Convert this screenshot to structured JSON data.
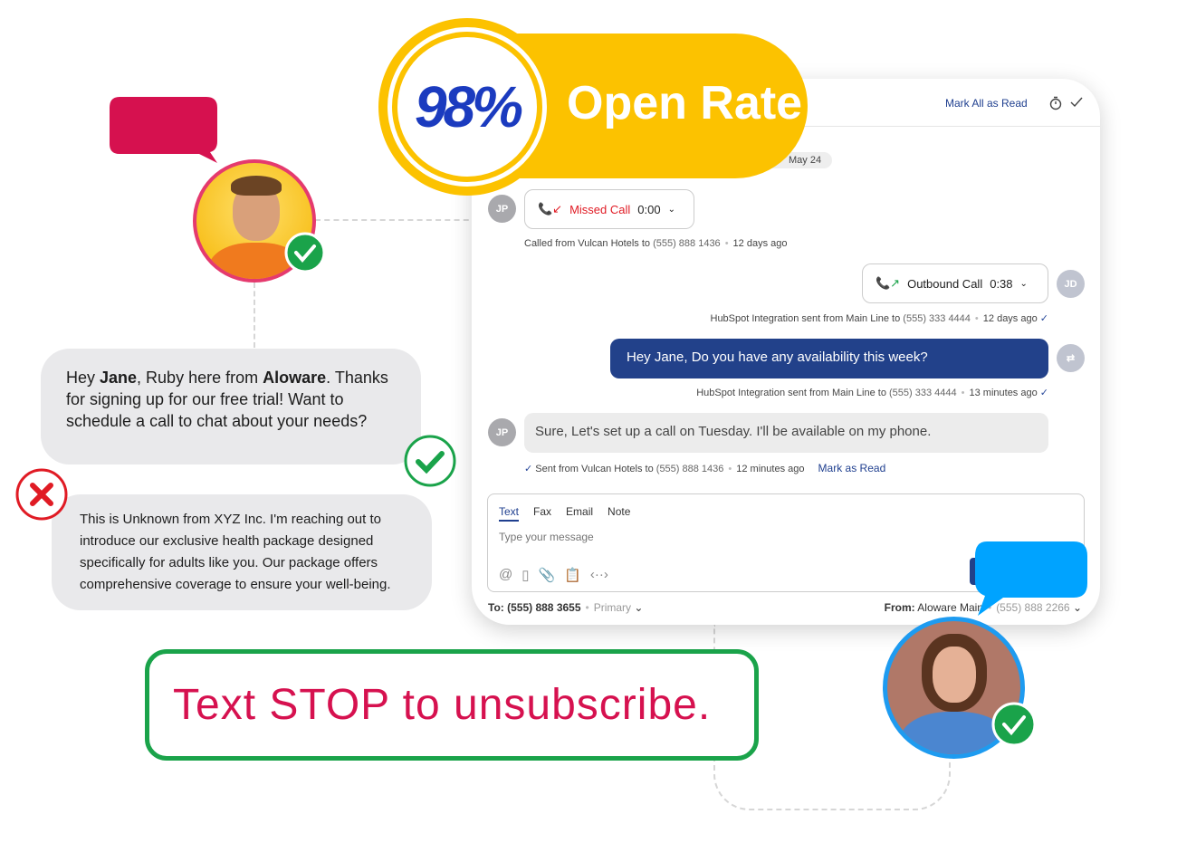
{
  "badge": {
    "percent": "98%",
    "label": "Open Rate",
    "colors": {
      "yellow": "#fcc200",
      "blue": "#1b3bbf"
    }
  },
  "header": {
    "mark_all_read": "Mark All as Read",
    "timer_icon": "stopwatch-icon",
    "check_icon": "check-icon"
  },
  "date_chip": "May 24",
  "messages": [
    {
      "avatar": "JP",
      "type": "missed-call",
      "label": "Missed Call",
      "duration": "0:00",
      "meta_from": "Called from Vulcan Hotels to",
      "meta_number": "(555) 888 1436",
      "meta_time": "12 days ago"
    },
    {
      "avatar": "JD",
      "type": "outbound-call",
      "label": "Outbound Call",
      "duration": "0:38",
      "meta_from": "HubSpot Integration sent from Main Line to",
      "meta_number": "(555) 333 4444",
      "meta_time": "12 days ago"
    },
    {
      "type": "outgoing-text",
      "text": "Hey Jane, Do you have any availability this week?",
      "meta_from": "HubSpot Integration sent from Main Line to",
      "meta_number": "(555) 333 4444",
      "meta_time": "13 minutes ago"
    },
    {
      "avatar": "JP",
      "type": "incoming-text",
      "text": "Sure, Let's set up a call on Tuesday.  I'll be available on my phone.",
      "meta_from": "Sent from Vulcan Hotels to",
      "meta_number": "(555) 888 1436",
      "meta_time": "12 minutes ago",
      "action": "Mark as Read"
    }
  ],
  "composer": {
    "tabs": [
      "Text",
      "Fax",
      "Email",
      "Note"
    ],
    "active_tab": "Text",
    "placeholder": "Type your message"
  },
  "footer": {
    "to_label": "To:",
    "to_number": "(555) 888 3655",
    "to_type": "Primary",
    "from_label": "From:",
    "from_name": "Aloware Main",
    "from_number": "(555) 888 2266"
  },
  "good_message": {
    "p1": "Hey ",
    "name": "Jane",
    "p2": ", Ruby here from ",
    "brand": "Aloware",
    "p3": ". Thanks for signing up for our free trial! Want to schedule a call to chat about your needs?"
  },
  "bad_message": "This is Unknown from XYZ Inc. I'm reaching out to introduce our exclusive health package designed specifically for adults like you. Our package offers comprehensive coverage to ensure your well-being.",
  "compliance_text": "Text STOP to unsubscribe."
}
